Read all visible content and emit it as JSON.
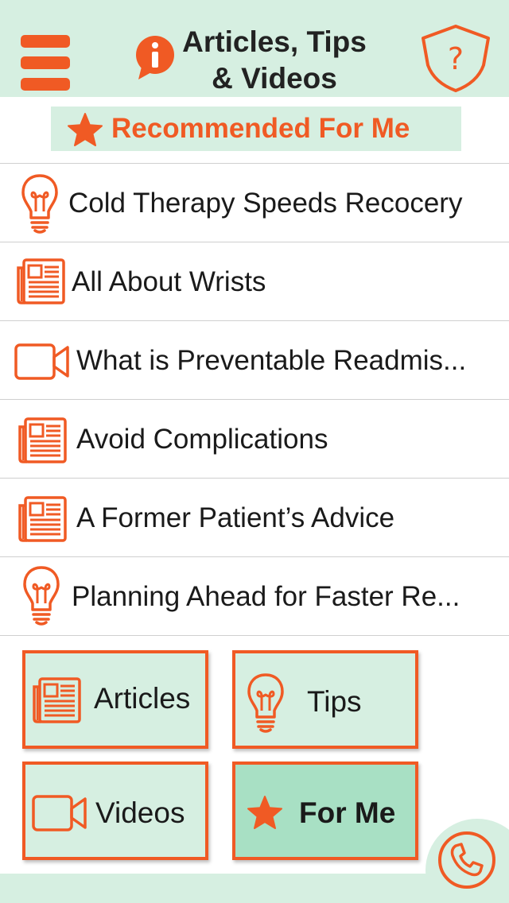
{
  "header": {
    "title_line1": "Articles, Tips",
    "title_line2": "& Videos",
    "menu_icon": "hamburger-menu-icon",
    "info_icon": "info-speech-bubble-icon",
    "help_icon": "question-shield-icon"
  },
  "recommended": {
    "label": "Recommended For Me",
    "icon": "star-icon"
  },
  "items": [
    {
      "icon": "lightbulb-icon",
      "title": "Cold Therapy Speeds Recocery"
    },
    {
      "icon": "newspaper-icon",
      "title": "All About Wrists"
    },
    {
      "icon": "video-camera-icon",
      "title": "What is Preventable Readmis..."
    },
    {
      "icon": "newspaper-icon",
      "title": "Avoid Complications"
    },
    {
      "icon": "newspaper-icon",
      "title": "A Former Patient’s Advice"
    },
    {
      "icon": "lightbulb-icon",
      "title": "Planning Ahead for Faster Re..."
    }
  ],
  "filters": {
    "articles": "Articles",
    "tips": "Tips",
    "videos": "Videos",
    "for_me": "For Me",
    "selected": "For Me"
  },
  "call_icon": "phone-icon",
  "colors": {
    "accent": "#f05a24",
    "mint": "#d6efe1",
    "selected": "#a8e0c4"
  }
}
